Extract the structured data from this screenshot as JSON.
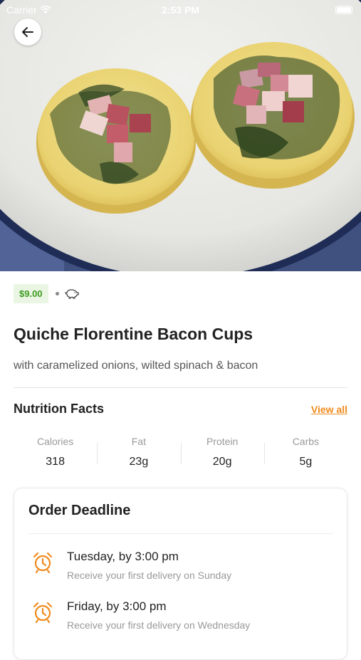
{
  "status_bar": {
    "carrier": "Carrier",
    "time": "2:53 PM"
  },
  "hero": {
    "image_alt": "quiche-photo"
  },
  "product": {
    "price": "$9.00",
    "title": "Quiche Florentine Bacon Cups",
    "subtitle": "with caramelized onions, wilted spinach & bacon",
    "icon": "pig-icon"
  },
  "nutrition": {
    "title": "Nutrition Facts",
    "view_all": "View all",
    "items": [
      {
        "label": "Calories",
        "value": "318"
      },
      {
        "label": "Fat",
        "value": "23g"
      },
      {
        "label": "Protein",
        "value": "20g"
      },
      {
        "label": "Carbs",
        "value": "5g"
      }
    ]
  },
  "order_deadline": {
    "title": "Order Deadline",
    "items": [
      {
        "main": "Tuesday, by 3:00 pm",
        "sub": "Receive your first delivery on Sunday"
      },
      {
        "main": "Friday, by 3:00 pm",
        "sub": "Receive your first delivery on Wednesday"
      }
    ]
  },
  "colors": {
    "accent": "#f08a1c",
    "price_text": "#3f9b22",
    "price_bg": "#eaf6e3"
  }
}
